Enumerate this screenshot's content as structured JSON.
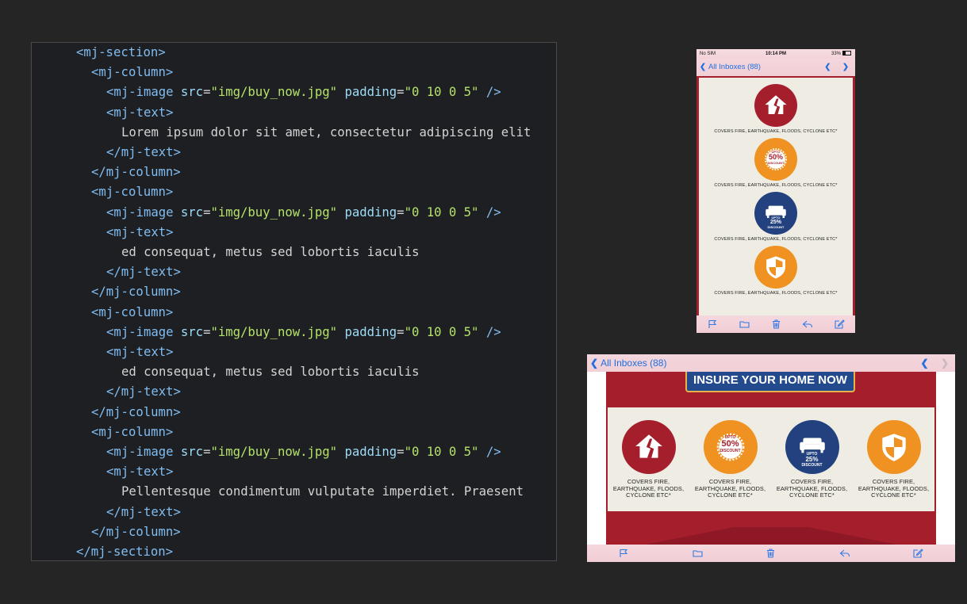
{
  "editor": {
    "lines": [
      {
        "indent": 0,
        "open": "<mj-section>"
      },
      {
        "indent": 1,
        "open": "<mj-column>"
      },
      {
        "indent": 2,
        "image": true
      },
      {
        "indent": 2,
        "open": "<mj-text>"
      },
      {
        "indent": 3,
        "text": "Lorem ipsum dolor sit amet, consectetur adipiscing elit"
      },
      {
        "indent": 2,
        "open": "</mj-text>"
      },
      {
        "indent": 1,
        "open": "</mj-column>"
      },
      {
        "indent": 1,
        "open": "<mj-column>"
      },
      {
        "indent": 2,
        "image": true
      },
      {
        "indent": 2,
        "open": "<mj-text>"
      },
      {
        "indent": 3,
        "text": "ed consequat, metus sed lobortis iaculis"
      },
      {
        "indent": 2,
        "open": "</mj-text>"
      },
      {
        "indent": 1,
        "open": "</mj-column>"
      },
      {
        "indent": 1,
        "open": "<mj-column>"
      },
      {
        "indent": 2,
        "image": true
      },
      {
        "indent": 2,
        "open": "<mj-text>"
      },
      {
        "indent": 3,
        "text": "ed consequat, metus sed lobortis iaculis"
      },
      {
        "indent": 2,
        "open": "</mj-text>"
      },
      {
        "indent": 1,
        "open": "</mj-column>"
      },
      {
        "indent": 1,
        "open": "<mj-column>"
      },
      {
        "indent": 2,
        "image": true
      },
      {
        "indent": 2,
        "open": "<mj-text>"
      },
      {
        "indent": 3,
        "text": "Pellentesque condimentum vulputate imperdiet. Praesent"
      },
      {
        "indent": 2,
        "open": "</mj-text>"
      },
      {
        "indent": 1,
        "open": "</mj-column>"
      },
      {
        "indent": 0,
        "open": "</mj-section>"
      }
    ],
    "image_tag": {
      "tag": "<mj-image",
      "src_attr": "src",
      "src_value": "\"img/buy_now.jpg\"",
      "padding_attr": "padding",
      "padding_value": "\"0 10 0 5\"",
      "close": "/>"
    }
  },
  "phone_portrait": {
    "status": {
      "carrier": "No SIM",
      "time": "10:14 PM",
      "battery": "33%"
    },
    "nav": {
      "back_label": "All Inboxes (88)"
    },
    "features": [
      {
        "icon": "house-crack-icon",
        "color": "#a51e2c",
        "caption": "COVERS FIRE, EARTHQUAKE, FLOODS, CYCLONE ETC*"
      },
      {
        "icon": "discount-badge-icon",
        "color": "#ef9221",
        "badge_text": "50%",
        "badge_top": "UPTO",
        "badge_bottom": "DISCOUNT",
        "caption": "COVERS FIRE, EARTHQUAKE, FLOODS, CYCLONE ETC*"
      },
      {
        "icon": "sofa-icon",
        "color": "#22417e",
        "badge_text": "25%",
        "badge_top": "UPTO",
        "badge_bottom": "DISCOUNT",
        "caption": "COVERS FIRE, EARTHQUAKE, FLOODS, CYCLONE ETC*"
      },
      {
        "icon": "shield-icon",
        "color": "#ef9221",
        "caption": "COVERS FIRE, EARTHQUAKE, FLOODS, CYCLONE ETC*"
      }
    ]
  },
  "phone_landscape": {
    "nav": {
      "back_label": "All Inboxes (88)"
    },
    "banner_title": "INSURE YOUR HOME NOW",
    "features": [
      {
        "caption_lines": [
          "COVERS FIRE,",
          "EARTHQUAKE, FLOODS,",
          "CYCLONE ETC*"
        ]
      },
      {
        "caption_lines": [
          "COVERS FIRE,",
          "EARTHQUAKE, FLOODS,",
          "CYCLONE ETC*"
        ]
      },
      {
        "caption_lines": [
          "COVERS FIRE,",
          "EARTHQUAKE, FLOODS,",
          "CYCLONE ETC*"
        ]
      },
      {
        "caption_lines": [
          "COVERS FIRE,",
          "EARTHQUAKE, FLOODS,",
          "CYCLONE ETC*"
        ]
      }
    ]
  },
  "toolbar_icons": [
    "flag-icon",
    "folder-icon",
    "trash-icon",
    "reply-icon",
    "compose-icon"
  ],
  "colors": {
    "accent_blue": "#2f7ae5",
    "brand_red": "#a51e2c",
    "brand_orange": "#ef9221",
    "brand_navy": "#22417e",
    "panel_beige": "#efede3"
  }
}
